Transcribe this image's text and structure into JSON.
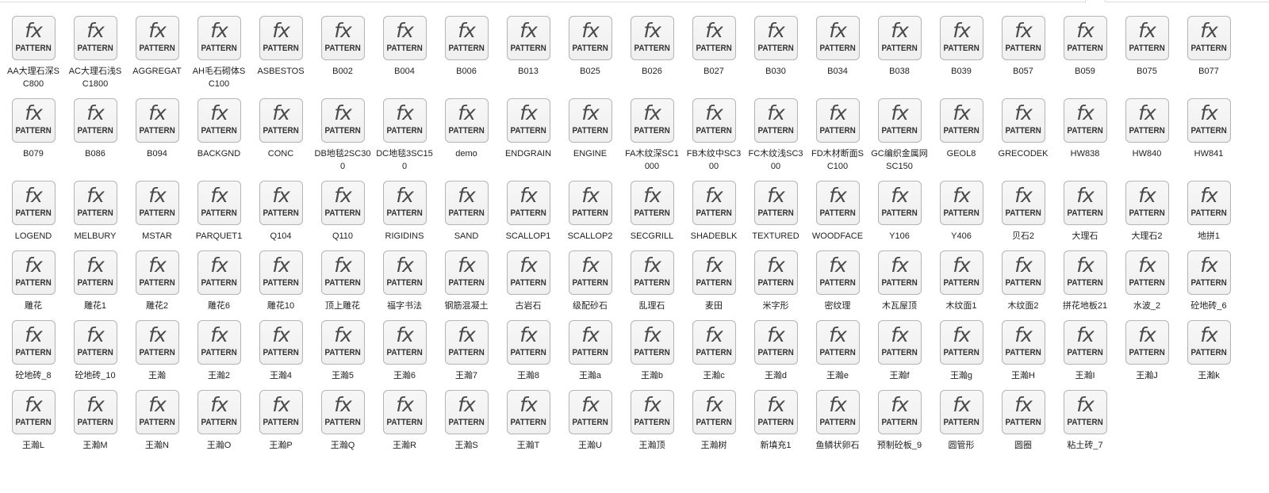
{
  "icon": {
    "glyph": "fx",
    "caption": "PATTERN",
    "name": "pattern-file-icon"
  },
  "items": [
    "AA大理石深SC800",
    "AC大理石浅SC1800",
    "AGGREGAT",
    "AH毛石砌体SC100",
    "ASBESTOS",
    "B002",
    "B004",
    "B006",
    "B013",
    "B025",
    "B026",
    "B027",
    "B030",
    "B034",
    "B038",
    "B039",
    "B057",
    "B059",
    "B075",
    "B077",
    "B079",
    "B086",
    "B094",
    "BACKGND",
    "CONC",
    "DB地毯2SC300",
    "DC地毯3SC150",
    "demo",
    "ENDGRAIN",
    "ENGINE",
    "FA木纹深SC1000",
    "FB木纹中SC300",
    "FC木纹浅SC300",
    "FD木材断面SC100",
    "GC编织金属网SC150",
    "GEOL8",
    "GRECODEK",
    "HW838",
    "HW840",
    "HW841",
    "LOGEND",
    "MELBURY",
    "MSTAR",
    "PARQUET1",
    "Q104",
    "Q110",
    "RIGIDINS",
    "SAND",
    "SCALLOP1",
    "SCALLOP2",
    "SECGRILL",
    "SHADEBLK",
    "TEXTURED",
    "WOODFACE",
    "Y106",
    "Y406",
    "贝石2",
    "大理石",
    "大理石2",
    "地拼1",
    "雕花",
    "雕花1",
    "雕花2",
    "雕花6",
    "雕花10",
    "顶上雕花",
    "福字书法",
    "钢筋混凝土",
    "古岩石",
    "级配砂石",
    "乱理石",
    "麦田",
    "米字形",
    "密纹理",
    "木瓦屋顶",
    "木纹面1",
    "木纹面2",
    "拼花地板21",
    "水波_2",
    "砼地砖_6",
    "砼地砖_8",
    "砼地砖_10",
    "王瀚",
    "王瀚2",
    "王瀚4",
    "王瀚5",
    "王瀚6",
    "王瀚7",
    "王瀚8",
    "王瀚a",
    "王瀚b",
    "王瀚c",
    "王瀚d",
    "王瀚e",
    "王瀚f",
    "王瀚g",
    "王瀚H",
    "王瀚I",
    "王瀚J",
    "王瀚k",
    "王瀚L",
    "王瀚M",
    "王瀚N",
    "王瀚O",
    "王瀚P",
    "王瀚Q",
    "王瀚R",
    "王瀚S",
    "王瀚T",
    "王瀚U",
    "王瀚顶",
    "王瀚树",
    "新填充1",
    "鱼鳞状卵石",
    "预制砼板_9",
    "圆管形",
    "圆圈",
    "粘土砖_7"
  ]
}
